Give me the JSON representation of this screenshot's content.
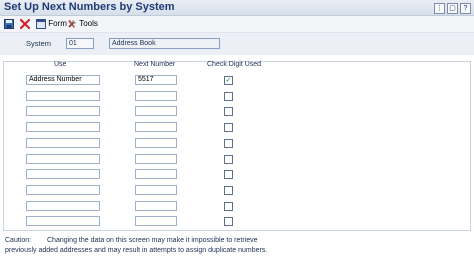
{
  "window": {
    "title": "Set Up Next Numbers by System",
    "btn_options": "⋮",
    "btn_restore": "▢",
    "btn_help": "?"
  },
  "toolbar": {
    "save_icon": "floppy-disk-icon",
    "close_icon": "red-x-icon",
    "form_label": "Form",
    "tools_label": "Tools"
  },
  "header": {
    "system_label": "System",
    "system_code": "01",
    "system_name": "Address Book"
  },
  "grid": {
    "col_use": "Use",
    "col_next_number": "Next Number",
    "col_check_digit": "Check Digit Used",
    "rows": [
      {
        "use": "Address Number",
        "next": "5517",
        "checked": true
      },
      {
        "use": "",
        "next": "",
        "checked": false
      },
      {
        "use": "",
        "next": "",
        "checked": false
      },
      {
        "use": "",
        "next": "",
        "checked": false
      },
      {
        "use": "",
        "next": "",
        "checked": false
      },
      {
        "use": "",
        "next": "",
        "checked": false
      },
      {
        "use": "",
        "next": "",
        "checked": false
      },
      {
        "use": "",
        "next": "",
        "checked": false
      },
      {
        "use": "",
        "next": "",
        "checked": false
      },
      {
        "use": "",
        "next": "",
        "checked": false
      }
    ]
  },
  "caution": {
    "label": "Caution:",
    "line1": "Changing the data on this screen may make it impossible to retrieve",
    "line2": "previously added addresses and may result in attempts to assign duplicate numbers."
  }
}
